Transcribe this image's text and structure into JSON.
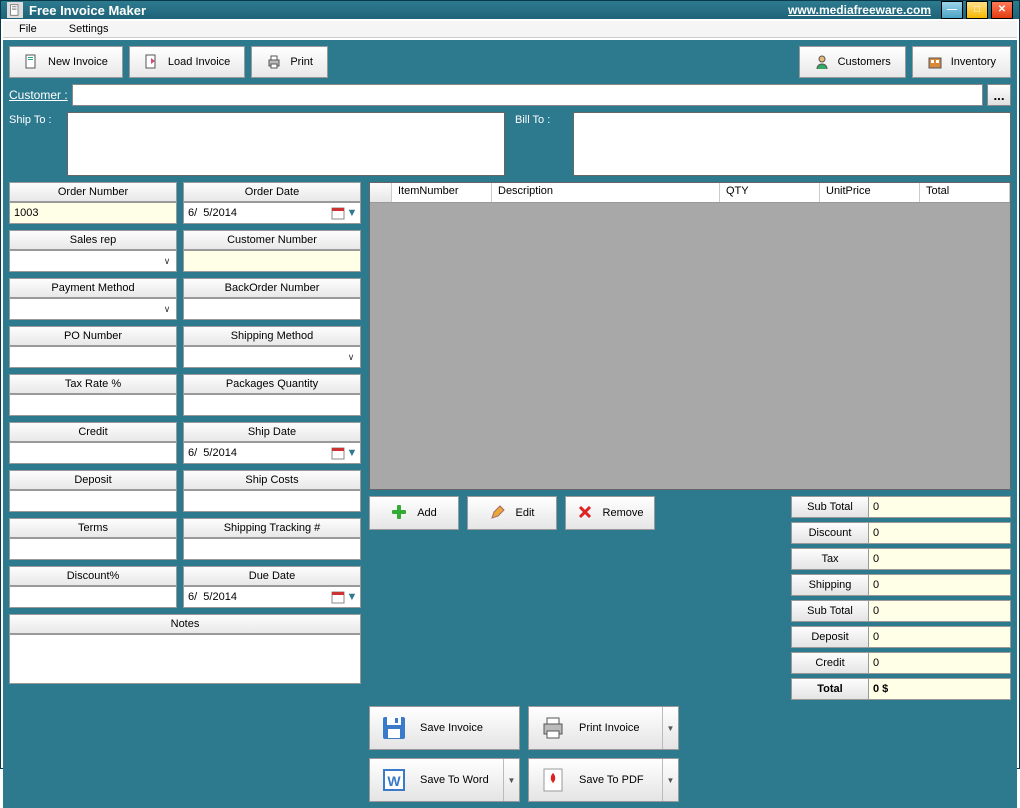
{
  "titlebar": {
    "title": "Free Invoice Maker",
    "link": "www.mediafreeware.com"
  },
  "menubar": {
    "file": "File",
    "settings": "Settings"
  },
  "toolbar": {
    "new_invoice": "New Invoice",
    "load_invoice": "Load Invoice",
    "print": "Print",
    "customers": "Customers",
    "inventory": "Inventory"
  },
  "customer": {
    "label": "Customer :",
    "value": "",
    "ellipsis": "..."
  },
  "shipto": {
    "label": "Ship To :",
    "value": ""
  },
  "billto": {
    "label": "Bill To :",
    "value": ""
  },
  "fields": {
    "order_number": {
      "label": "Order Number",
      "value": "1003"
    },
    "order_date": {
      "label": "Order Date",
      "value": "6/  5/2014"
    },
    "sales_rep": {
      "label": "Sales rep",
      "value": ""
    },
    "customer_number": {
      "label": "Customer Number",
      "value": ""
    },
    "payment_method": {
      "label": "Payment Method",
      "value": ""
    },
    "backorder_number": {
      "label": "BackOrder Number",
      "value": ""
    },
    "po_number": {
      "label": "PO Number",
      "value": ""
    },
    "shipping_method": {
      "label": "Shipping Method",
      "value": ""
    },
    "tax_rate": {
      "label": "Tax Rate %",
      "value": ""
    },
    "packages_qty": {
      "label": "Packages Quantity",
      "value": ""
    },
    "credit": {
      "label": "Credit",
      "value": ""
    },
    "ship_date": {
      "label": "Ship Date",
      "value": "6/  5/2014"
    },
    "deposit": {
      "label": "Deposit",
      "value": ""
    },
    "ship_costs": {
      "label": "Ship Costs",
      "value": ""
    },
    "terms": {
      "label": "Terms",
      "value": ""
    },
    "shipping_tracking": {
      "label": "Shipping Tracking #",
      "value": ""
    },
    "discount_pct": {
      "label": "Discount%",
      "value": ""
    },
    "due_date": {
      "label": "Due Date",
      "value": "6/  5/2014"
    },
    "notes": {
      "label": "Notes",
      "value": ""
    }
  },
  "grid": {
    "columns": {
      "item_number": "ItemNumber",
      "description": "Description",
      "qty": "QTY",
      "unit_price": "UnitPrice",
      "total": "Total"
    }
  },
  "grid_actions": {
    "add": "Add",
    "edit": "Edit",
    "remove": "Remove"
  },
  "save_buttons": {
    "save_invoice": "Save Invoice",
    "print_invoice": "Print Invoice",
    "save_word": "Save To Word",
    "save_pdf": "Save To PDF"
  },
  "totals": {
    "sub_total": {
      "label": "Sub Total",
      "value": "0"
    },
    "discount": {
      "label": "Discount",
      "value": "0"
    },
    "tax": {
      "label": "Tax",
      "value": "0"
    },
    "shipping": {
      "label": "Shipping",
      "value": "0"
    },
    "sub_total2": {
      "label": "Sub Total",
      "value": "0"
    },
    "deposit": {
      "label": "Deposit",
      "value": "0"
    },
    "credit": {
      "label": "Credit",
      "value": "0"
    },
    "total": {
      "label": "Total",
      "value": "0 $"
    }
  }
}
